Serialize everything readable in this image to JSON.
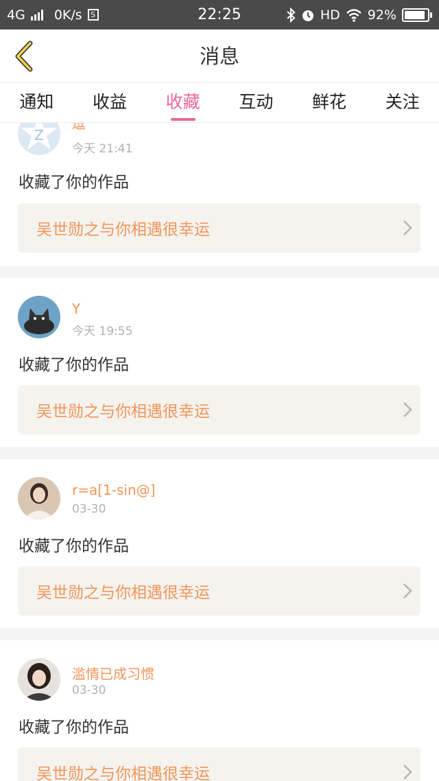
{
  "status_bar": {
    "network": "4G",
    "speed": "0K/s",
    "s_icon": "S",
    "time": "22:25",
    "hd": "HD",
    "battery": "92%",
    "battery_level": 0.92
  },
  "header": {
    "title": "消息",
    "back_icon": "chevron-left-icon"
  },
  "tabs": [
    {
      "label": "通知"
    },
    {
      "label": "收益"
    },
    {
      "label": "收藏",
      "active": true
    },
    {
      "label": "互动"
    },
    {
      "label": "鲜花"
    },
    {
      "label": "关注"
    }
  ],
  "messages": [
    {
      "user": "逗",
      "time": "今天 21:41",
      "action": "收藏了你的作品",
      "work": "吴世勋之与你相遇很幸运"
    },
    {
      "user": "Y",
      "time": "今天 19:55",
      "action": "收藏了你的作品",
      "work": "吴世勋之与你相遇很幸运"
    },
    {
      "user": "r=a[1-sin@]",
      "time": "03-30",
      "action": "收藏了你的作品",
      "work": "吴世勋之与你相遇很幸运"
    },
    {
      "user": "滥情已成习惯",
      "time": "03-30",
      "action": "收藏了你的作品",
      "work": "吴世勋之与你相遇很幸运"
    }
  ],
  "colors": {
    "accent": "#e8679a",
    "name": "#f2945a",
    "card_bg": "#f4f3ee"
  }
}
